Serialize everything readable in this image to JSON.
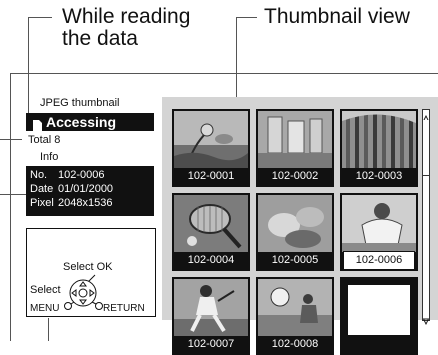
{
  "callouts": {
    "while_reading": "While reading\nthe data",
    "thumbnail_view": "Thumbnail view"
  },
  "screen": {
    "mode_label": "JPEG thumbnail",
    "status": "Accessing",
    "total": "Total 8",
    "info_label": "Info",
    "info": {
      "no_label": "No.",
      "no_value": "102-0006",
      "date_label": "Date",
      "date_value": "01/01/2000",
      "pixel_label": "Pixel",
      "pixel_value": "2048x1536"
    },
    "nav": {
      "select_ok": "Select  OK",
      "select": "Select",
      "menu": "MENU",
      "return": "RETURN"
    },
    "thumbnails": [
      {
        "label": "102-0001",
        "scene": "flower-icon"
      },
      {
        "label": "102-0002",
        "scene": "glasses-icon"
      },
      {
        "label": "102-0003",
        "scene": "forest-icon"
      },
      {
        "label": "102-0004",
        "scene": "racket-icon"
      },
      {
        "label": "102-0005",
        "scene": "food-icon"
      },
      {
        "label": "102-0006",
        "scene": "football-icon"
      },
      {
        "label": "102-0007",
        "scene": "tennis-player-icon"
      },
      {
        "label": "102-0008",
        "scene": "soccer-icon"
      }
    ],
    "selected_index": 5
  },
  "colors": {
    "panel_bg": "#d4d4d4",
    "frame": "#111111",
    "text_inverse": "#ffffff"
  }
}
